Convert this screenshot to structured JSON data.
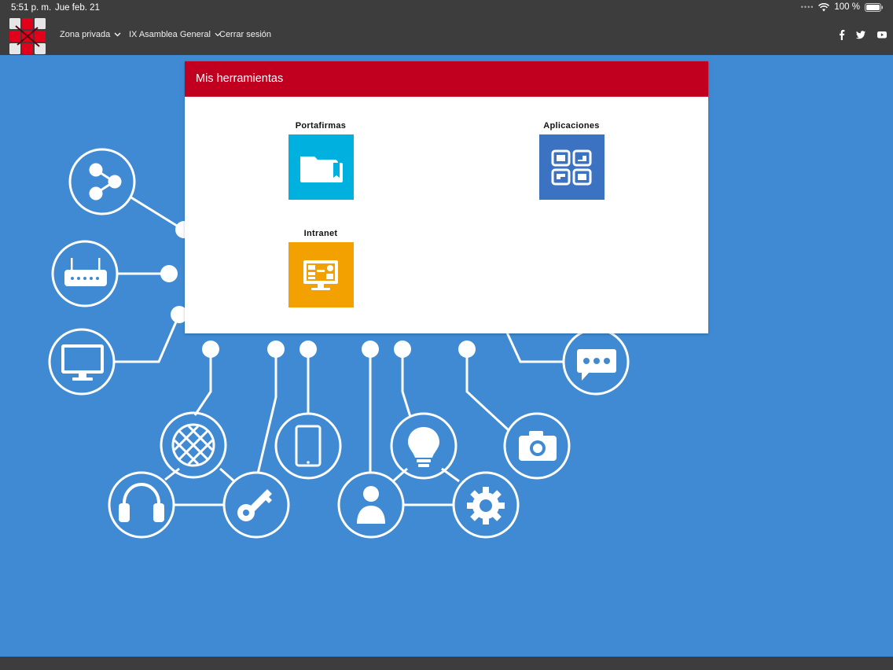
{
  "status_bar": {
    "time": "5:51 p. m.",
    "date": "Jue feb. 21",
    "battery": "100 %"
  },
  "nav": {
    "items": [
      {
        "label": "Zona privada",
        "has_dropdown": true
      },
      {
        "label": "IX Asamblea General",
        "has_dropdown": true
      },
      {
        "label": "Cerrar sesión",
        "has_dropdown": false
      }
    ],
    "social": [
      "facebook-icon",
      "twitter-icon",
      "youtube-icon"
    ]
  },
  "panel": {
    "title": "Mis herramientas",
    "tools": [
      {
        "label": "Portafirmas",
        "icon": "folder-icon",
        "color": "#00b0de"
      },
      {
        "label": "Aplicaciones",
        "icon": "apps-grid-icon",
        "color": "#3b72c2"
      },
      {
        "label": "Intranet",
        "icon": "monitor-dashboard-icon",
        "color": "#f2a100"
      }
    ]
  },
  "colors": {
    "bar_bg": "#3d3d3d",
    "background_blue": "#3f8ad2",
    "header_red": "#c1001f"
  }
}
